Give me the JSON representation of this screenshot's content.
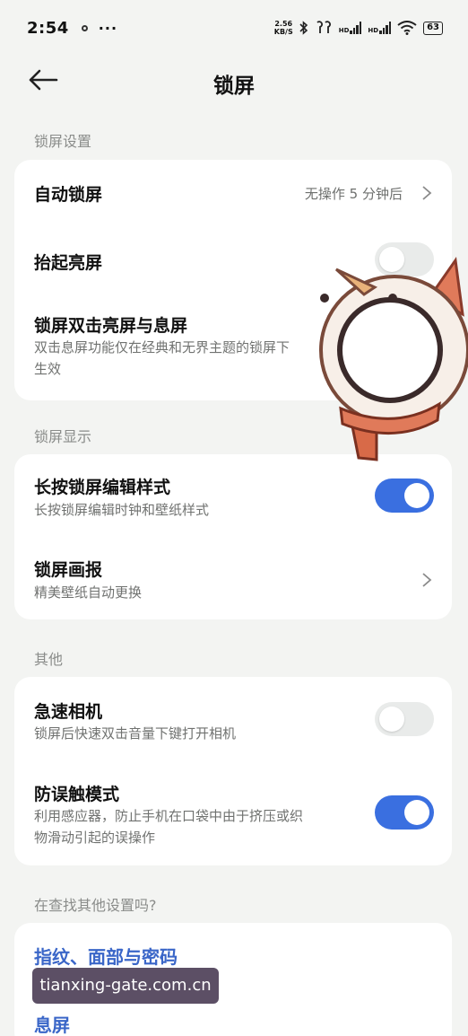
{
  "status_bar": {
    "time": "2:54",
    "more": "···",
    "speed_value": "2.56",
    "speed_unit": "KB/S",
    "hd1": "HD",
    "hd2": "HD",
    "battery": "63",
    "icons": [
      "circle-notification-icon",
      "bluetooth-icon",
      "earbuds-icon",
      "signal-icon",
      "signal-icon",
      "wifi-icon",
      "battery-icon"
    ]
  },
  "header": {
    "title": "锁屏",
    "back_icon": "back-arrow-icon"
  },
  "sections": {
    "lock_settings": {
      "label": "锁屏设置",
      "auto_lock": {
        "title": "自动锁屏",
        "value": "无操作 5 分钟后"
      },
      "raise_to_wake": {
        "title": "抬起亮屏",
        "enabled": false
      },
      "double_tap": {
        "title": "锁屏双击亮屏与息屏",
        "subtitle_line1": "双击息屏功能仅在经典和无界主题的锁屏下",
        "subtitle_line2": "生效",
        "enabled": true
      }
    },
    "lock_display": {
      "label": "锁屏显示",
      "long_press": {
        "title": "长按锁屏编辑样式",
        "subtitle": "长按锁屏编辑时钟和壁纸样式",
        "enabled": true
      },
      "magazine": {
        "title": "锁屏画报",
        "subtitle": "精美壁纸自动更换"
      }
    },
    "others": {
      "label": "其他",
      "quick_camera": {
        "title": "急速相机",
        "subtitle": "锁屏后快速双击音量下键打开相机",
        "enabled": false
      },
      "anti_touch": {
        "title": "防误触模式",
        "subtitle_line1": "利用感应器，防止手机在口袋中由于挤压或织",
        "subtitle_line2": "物滑动引起的误操作",
        "enabled": true
      }
    },
    "search": {
      "label": "在查找其他设置吗?",
      "links": [
        "指纹、面部与密码",
        "息屏"
      ]
    }
  },
  "watermark": "tianxing-gate.com.cn",
  "colors": {
    "accent": "#3a6fe0",
    "link": "#3a66c8",
    "background": "#f3f4f2",
    "card": "#ffffff"
  }
}
